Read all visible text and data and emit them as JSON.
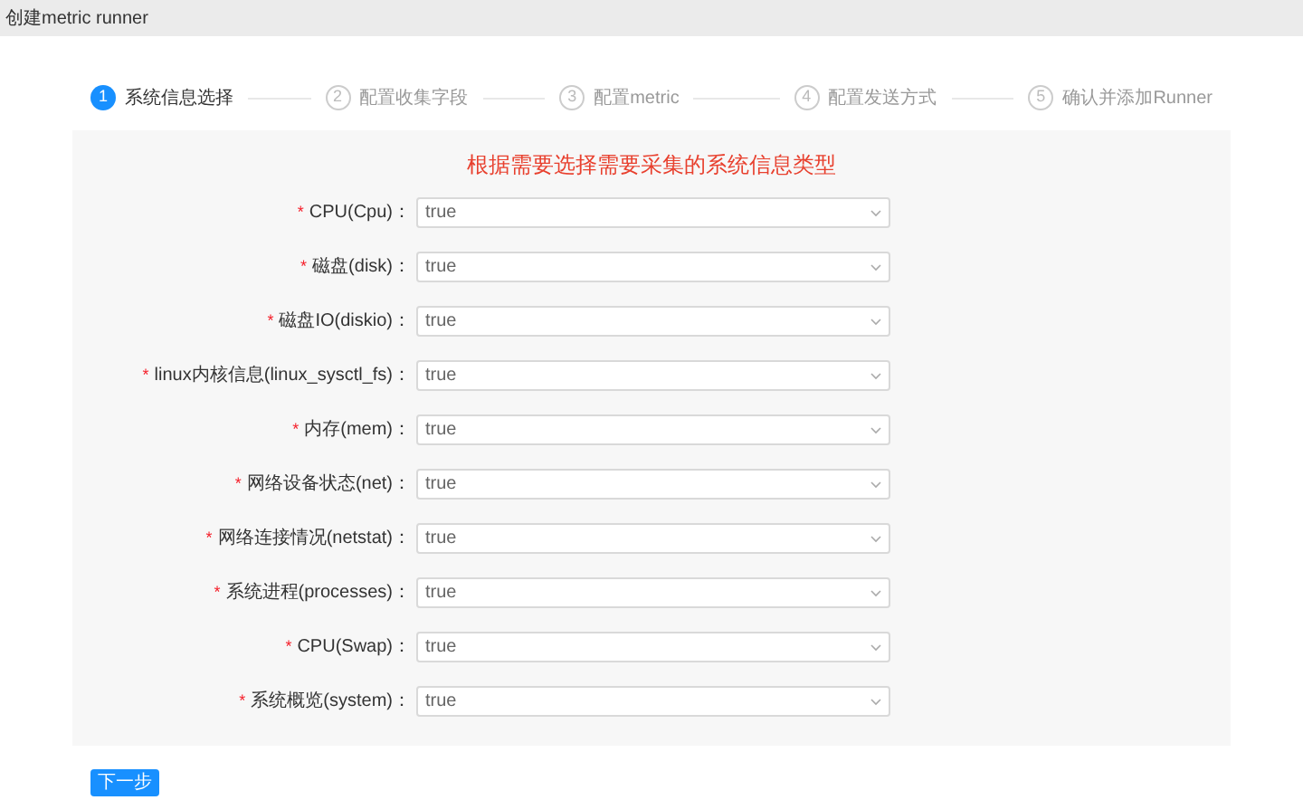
{
  "window": {
    "title": "创建metric runner"
  },
  "steps": [
    {
      "number": "1",
      "label": "系统信息选择",
      "selected": true
    },
    {
      "number": "2",
      "label": "配置收集字段",
      "selected": false
    },
    {
      "number": "3",
      "label": "配置metric",
      "selected": false
    },
    {
      "number": "4",
      "label": "配置发送方式",
      "selected": false
    },
    {
      "number": "5",
      "label": "确认并添加Runner",
      "selected": false
    }
  ],
  "form": {
    "heading": "根据需要选择需要采集的系统信息类型",
    "fields": [
      {
        "mark": "*",
        "label": "CPU(Cpu)：",
        "value": "true"
      },
      {
        "mark": "*",
        "label": "磁盘(disk)：",
        "value": "true"
      },
      {
        "mark": "*",
        "label": "磁盘IO(diskio)：",
        "value": "true"
      },
      {
        "mark": "*",
        "label": "linux内核信息(linux_sysctl_fs)：",
        "value": "true"
      },
      {
        "mark": "*",
        "label": "内存(mem)：",
        "value": "true"
      },
      {
        "mark": "*",
        "label": "网络设备状态(net)：",
        "value": "true"
      },
      {
        "mark": "*",
        "label": "网络连接情况(netstat)：",
        "value": "true"
      },
      {
        "mark": "*",
        "label": "系统进程(processes)：",
        "value": "true"
      },
      {
        "mark": "*",
        "label": "CPU(Swap)：",
        "value": "true"
      },
      {
        "mark": "*",
        "label": "系统概览(system)：",
        "value": "true"
      }
    ]
  },
  "next_button": "下一步"
}
